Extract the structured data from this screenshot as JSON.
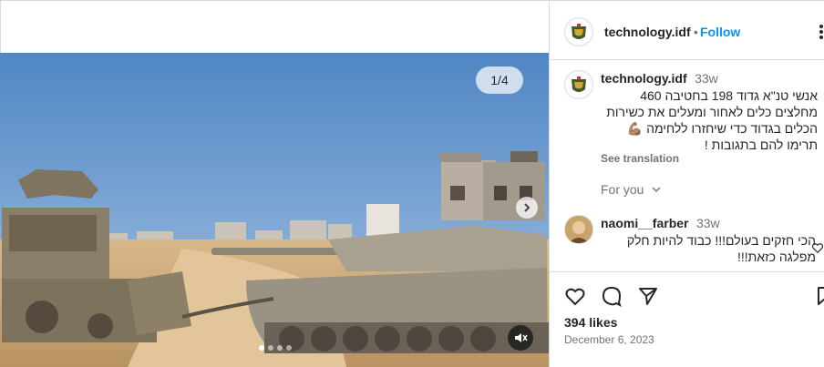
{
  "post": {
    "media": {
      "counter": "1/4",
      "slide_count": 4,
      "active_slide": 1
    },
    "header": {
      "username": "technology.idf",
      "separator": "•",
      "follow_label": "Follow"
    },
    "caption": {
      "username": "technology.idf",
      "time": "33w",
      "text_line1": "אנשי טנ\"א גדוד 198 בחטיבה 460",
      "text_line2": "מחלצים כלים לאחור ומעלים את כשירות",
      "text_line3": "הכלים בגדוד כדי שיחזרו ללחימה 💪🏽",
      "text_line4": "תרימו להם בתגובות !",
      "see_translation": "See translation"
    },
    "for_you": "For you",
    "comment": {
      "username": "naomi__farber",
      "time": "33w",
      "text_line1": "הכי חזקים בעולם!!! כבוד להיות חלק",
      "text_line2": "מפלגה כזאת!!!"
    },
    "likes": "394 likes",
    "date": "December 6, 2023",
    "colors": {
      "accent": "#0095f6",
      "text": "#262626",
      "muted": "#737373",
      "border": "#dbdbdb"
    },
    "icons": [
      "more-icon",
      "heart-icon",
      "comment-icon",
      "share-icon",
      "save-icon",
      "next-arrow-icon",
      "mute-icon"
    ]
  }
}
